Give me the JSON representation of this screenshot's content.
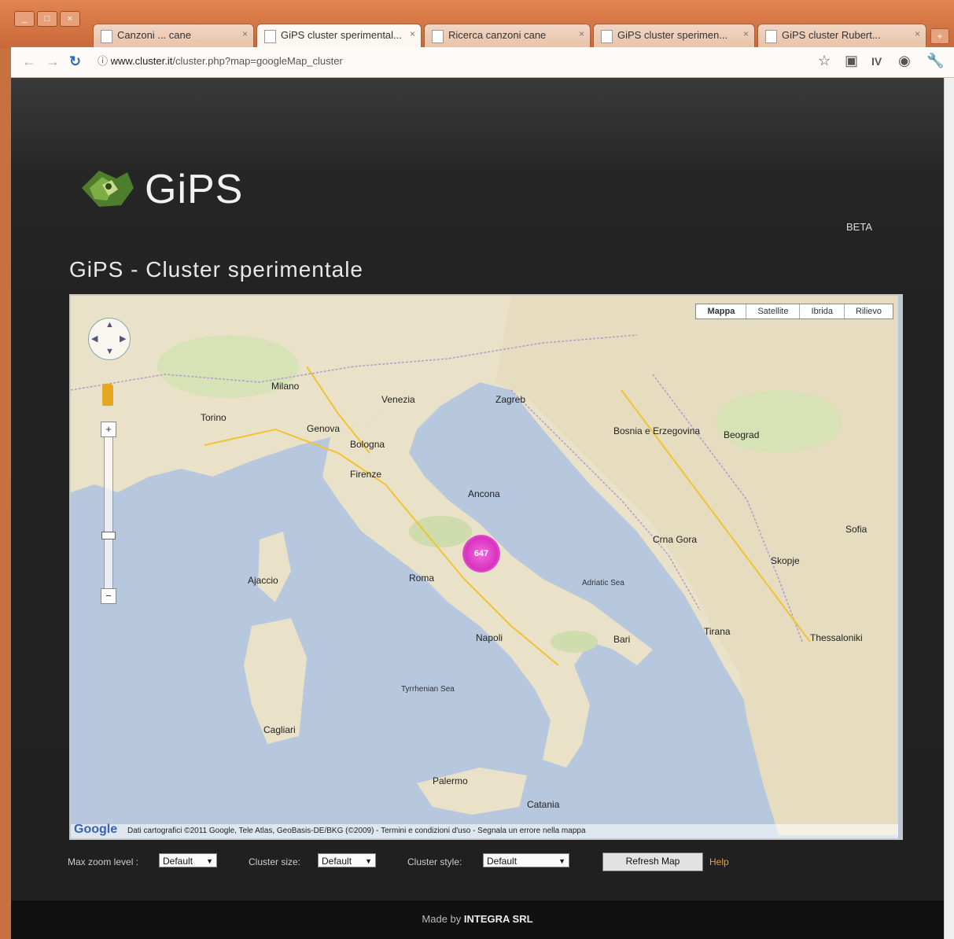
{
  "browser": {
    "window_buttons": [
      "_",
      "□",
      "×"
    ],
    "tabs": [
      {
        "title": "Canzoni ... cane",
        "active": false
      },
      {
        "title": "GiPS cluster sperimental...",
        "active": true
      },
      {
        "title": "Ricerca canzoni cane",
        "active": false
      },
      {
        "title": "GiPS cluster sperimen...",
        "active": false
      },
      {
        "title": "GiPS cluster Rubert...",
        "active": false
      }
    ],
    "tab_close": "×",
    "new_tab": "+",
    "url_host": "www.cluster.it",
    "url_path": "/cluster.php?map=googleMap_cluster",
    "toolbar_icons": [
      "star-icon",
      "page-icon",
      "extension-icon",
      "settings-icon",
      "wrench-icon"
    ]
  },
  "site": {
    "brand": "GiPS",
    "beta": "BETA",
    "page_title": "GiPS - Cluster sperimentale"
  },
  "map": {
    "type_buttons": [
      "Mappa",
      "Satellite",
      "Ibrida",
      "Rilievo"
    ],
    "zoom_in": "+",
    "zoom_out": "−",
    "cluster_label": "647",
    "places": {
      "ancona": "Ancona",
      "roma": "Roma",
      "napoli": "Napoli",
      "bari": "Bari",
      "palermo": "Palermo",
      "cagliari": "Cagliari",
      "milano": "Milano",
      "torino": "Torino",
      "genova": "Genova",
      "firenze": "Firenze",
      "venezia": "Venezia",
      "bologna": "Bologna",
      "zagreb": "Zagreb",
      "sarajevo": "Bosnia e Erzegovina",
      "belgrade": "Beograd",
      "podgorica": "Crna Gora",
      "tirana": "Tirana",
      "thessaloniki": "Thessaloniki",
      "sofia": "Sofia",
      "skopje": "Skopje",
      "ajaccio": "Ajaccio",
      "catania": "Catania",
      "tyrrhenian": "Tyrrhenian Sea",
      "adriatic": "Adriatic Sea"
    },
    "google_logo": "Google",
    "attribution": "Dati cartografici ©2011 Google, Tele Atlas, GeoBasis-DE/BKG (©2009) - Termini e condizioni d'uso - Segnala un errore nella mappa"
  },
  "controls": {
    "max_zoom_label": "Max zoom level :",
    "max_zoom_value": "Default",
    "cluster_size_label": "Cluster size:",
    "cluster_size_value": "Default",
    "cluster_style_label": "Cluster style:",
    "cluster_style_value": "Default",
    "refresh_label": "Refresh Map",
    "help_label": "Help"
  },
  "footer": {
    "prefix": "Made by",
    "company": "INTEGRA SRL"
  },
  "colors": {
    "sea": "#b6c7de",
    "land": "#eae2c8",
    "cluster": "#d933c1",
    "page_bg": "#222222",
    "tab_strip": "#c9683a"
  }
}
